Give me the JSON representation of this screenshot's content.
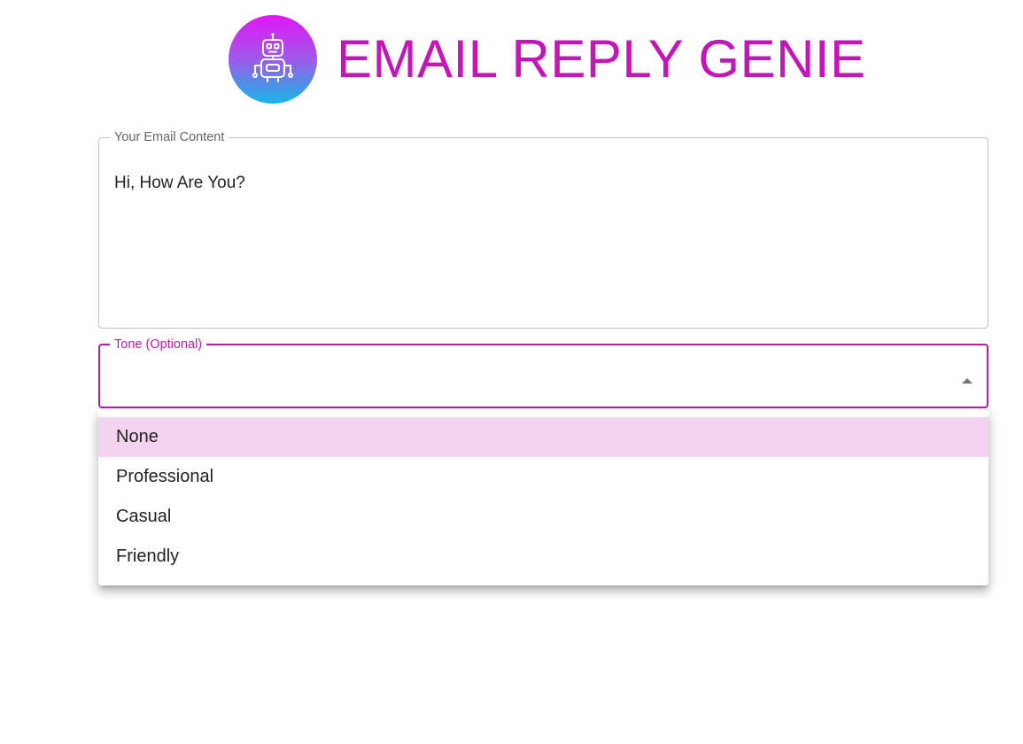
{
  "header": {
    "title": "EMAIL REPLY GENIE",
    "logo_icon": "robot-icon",
    "logo_gradient": [
      "#e216f5",
      "#16b7e6"
    ],
    "title_color": "#c416b8"
  },
  "email_field": {
    "label": "Your Email Content",
    "value": "Hi, How Are You?"
  },
  "tone_field": {
    "label": "Tone (Optional)",
    "value": "",
    "accent_color": "#b91ba8",
    "dropdown_icon": "caret-up-icon",
    "options": [
      "None",
      "Professional",
      "Casual",
      "Friendly"
    ],
    "highlighted_option": "None"
  }
}
